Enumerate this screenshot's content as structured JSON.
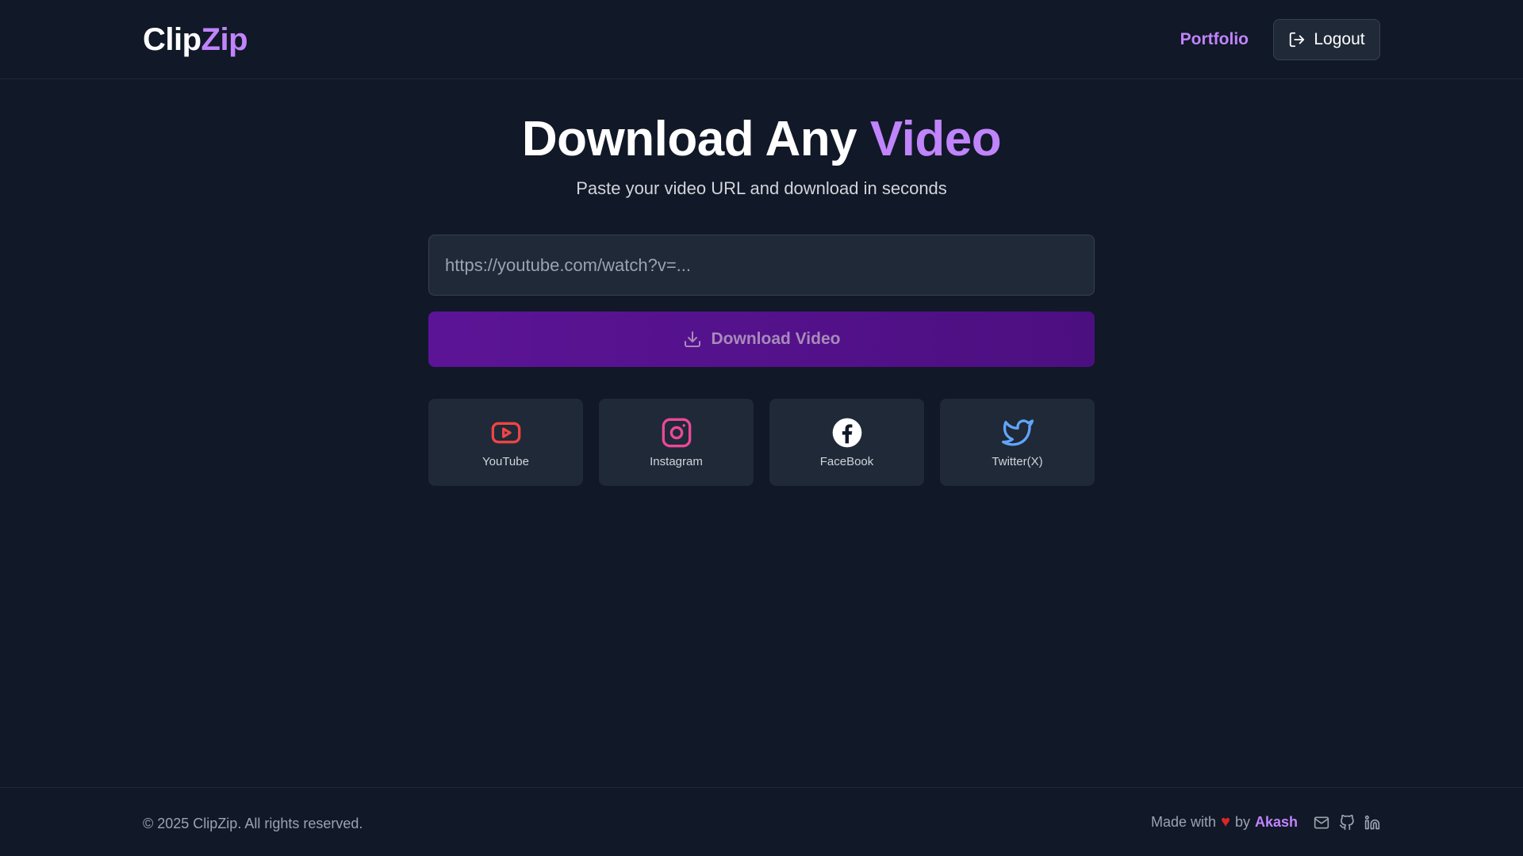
{
  "brand": {
    "part1": "Clip",
    "part2": "Zip"
  },
  "nav": {
    "portfolio_label": "Portfolio",
    "logout_label": "Logout"
  },
  "hero": {
    "title_part1": "Download Any ",
    "title_part2": "Video",
    "subtitle": "Paste your video URL and download in seconds"
  },
  "form": {
    "url_placeholder": "https://youtube.com/watch?v=...",
    "url_value": "",
    "download_label": "Download Video"
  },
  "platforms": [
    {
      "label": "YouTube",
      "icon": "youtube-icon",
      "color": "#ef4444"
    },
    {
      "label": "Instagram",
      "icon": "instagram-icon",
      "color": "#ec4899"
    },
    {
      "label": "FaceBook",
      "icon": "facebook-icon",
      "color": "#ffffff"
    },
    {
      "label": "Twitter(X)",
      "icon": "twitter-icon",
      "color": "#60a5fa"
    }
  ],
  "footer": {
    "copyright": "© 2025 ClipZip. All rights reserved.",
    "made_with": "Made with",
    "by": "by",
    "author": "Akash",
    "social_icons": [
      "mail-icon",
      "github-icon",
      "linkedin-icon"
    ]
  },
  "colors": {
    "background": "#111827",
    "accent": "#c084fc",
    "card": "#1f2937",
    "button": "#581c87"
  }
}
